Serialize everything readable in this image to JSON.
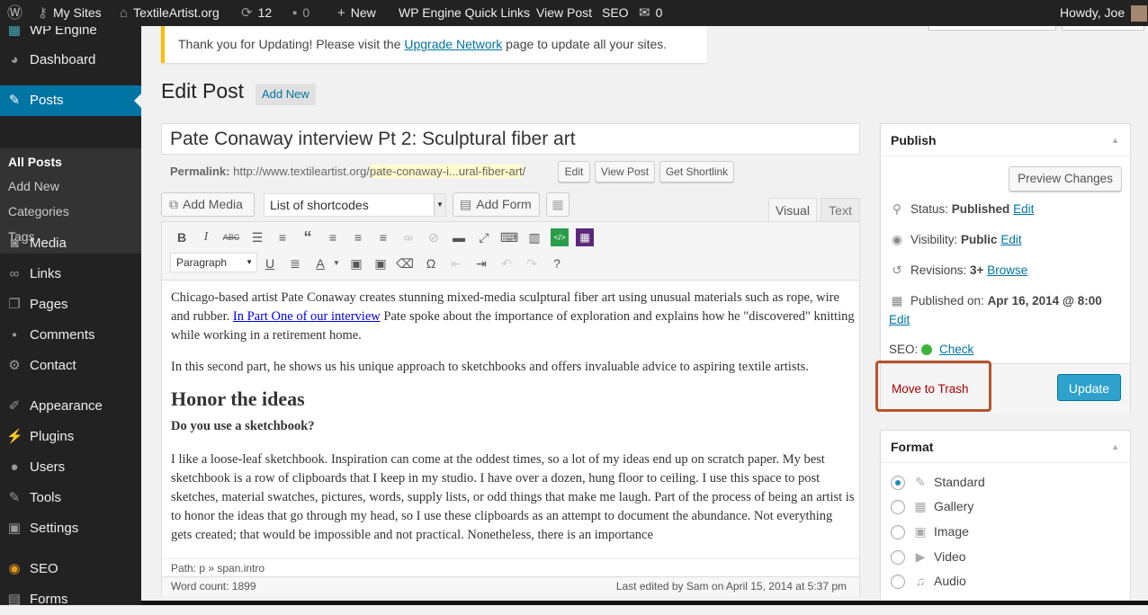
{
  "admin_bar": {
    "my_sites": "My Sites",
    "site_name": "TextileArtist.org",
    "updates_count": "12",
    "comments_count": "0",
    "new_label": "New",
    "wp_engine_links": "WP Engine Quick Links",
    "view_post": "View Post",
    "seo": "SEO",
    "mail_count": "0",
    "howdy": "Howdy, Joe"
  },
  "sidebar": {
    "items": [
      {
        "label": "WP Engine",
        "icon": "wp-engine-icon"
      },
      {
        "label": "Dashboard",
        "icon": "dashboard-icon"
      },
      {
        "label": "Posts",
        "icon": "pin-icon"
      },
      {
        "label": "Media",
        "icon": "media-icon"
      },
      {
        "label": "Links",
        "icon": "links-icon"
      },
      {
        "label": "Pages",
        "icon": "pages-icon"
      },
      {
        "label": "Comments",
        "icon": "comments-icon"
      },
      {
        "label": "Contact",
        "icon": "contact-icon"
      },
      {
        "label": "Appearance",
        "icon": "appearance-icon"
      },
      {
        "label": "Plugins",
        "icon": "plugins-icon"
      },
      {
        "label": "Users",
        "icon": "users-icon"
      },
      {
        "label": "Tools",
        "icon": "tools-icon"
      },
      {
        "label": "Settings",
        "icon": "settings-icon"
      },
      {
        "label": "SEO",
        "icon": "seo-icon"
      },
      {
        "label": "Forms",
        "icon": "forms-icon"
      }
    ],
    "submenu": [
      "All Posts",
      "Add New",
      "Categories",
      "Tags"
    ]
  },
  "notice": {
    "before": "Thank you for Updating! Please visit the ",
    "link": "Upgrade Network",
    "after": " page to update all your sites."
  },
  "page": {
    "title": "Edit Post",
    "add_new": "Add New"
  },
  "post": {
    "title": "Pate Conaway interview Pt 2: Sculptural fiber art",
    "permalink_label": "Permalink:",
    "permalink_base": "http://www.textileartist.org/",
    "permalink_slug": "pate-conaway-i...ural-fiber-art",
    "permalink_end": "/",
    "edit_btn": "Edit",
    "view_post_btn": "View Post",
    "shortlink_btn": "Get Shortlink"
  },
  "editor": {
    "add_media": "Add Media",
    "shortcodes": "List of shortcodes",
    "add_form": "Add Form",
    "tab_visual": "Visual",
    "tab_text": "Text",
    "format_select": "Paragraph",
    "p1_a": "Chicago-based artist Pate Conaway creates stunning mixed-media sculptural fiber art using unusual materials such as rope, wire and rubber. ",
    "p1_link": "In Part One of our interview",
    "p1_b": " Pate spoke about the importance of exploration and explains how he \"discovered\" knitting while working in a retirement home.",
    "p2": "In this second part, he shows us his unique approach to sketchbooks and offers invaluable advice to aspiring textile artists.",
    "h2": "Honor the ideas",
    "q": "Do you use a sketchbook?",
    "p3": "I like a loose-leaf sketchbook. Inspiration can come at the oddest times, so a lot of my ideas end up on scratch paper. My best sketchbook is a row of clipboards that I keep in my studio. I have over a dozen, hung floor to ceiling. I use this space to post sketches, material swatches, pictures, words, supply lists, or odd things that make me laugh. Part of the process of being an artist is to honor the ideas that go through my head, so I use these clipboards as an attempt to document the abundance. Not everything gets created; that would be impossible and not practical. Nonetheless, there is an importance",
    "path": "Path: p » span.intro",
    "word_count": "Word count: 1899",
    "last_edited": "Last edited by Sam on April 15, 2014 at 5:37 pm"
  },
  "publish": {
    "title": "Publish",
    "preview": "Preview Changes",
    "status_label": "Status: ",
    "status_value": "Published",
    "visibility_label": "Visibility: ",
    "visibility_value": "Public",
    "revisions_label": "Revisions: ",
    "revisions_value": "3+",
    "browse": "Browse",
    "published_label": "Published on: ",
    "published_value": "Apr 16, 2014 @ 8:00",
    "edit": "Edit",
    "seo_label": "SEO:",
    "seo_check": "Check",
    "seo_color": "#3cb43c",
    "trash": "Move to Trash",
    "update": "Update"
  },
  "format": {
    "title": "Format",
    "options": [
      {
        "label": "Standard",
        "icon": "pin-icon",
        "checked": true
      },
      {
        "label": "Gallery",
        "icon": "gallery-icon",
        "checked": false
      },
      {
        "label": "Image",
        "icon": "image-icon",
        "checked": false
      },
      {
        "label": "Video",
        "icon": "video-icon",
        "checked": false
      },
      {
        "label": "Audio",
        "icon": "audio-icon",
        "checked": false
      }
    ]
  }
}
